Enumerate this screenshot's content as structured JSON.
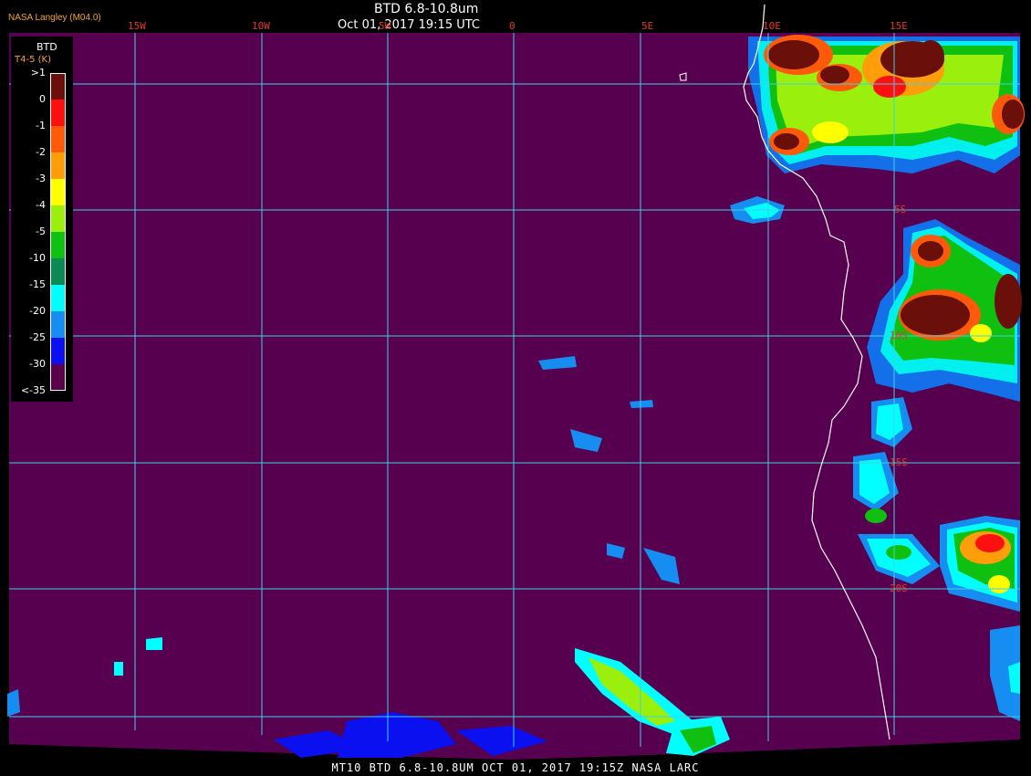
{
  "header": {
    "title": "BTD 6.8-10.8um",
    "subtitle": "Oct 01, 2017 19:15 UTC",
    "org": "NASA Langley (M04.0)"
  },
  "legend": {
    "title": "BTD",
    "subtitle": "T4-5 (K)",
    "items": [
      {
        "label": ">1",
        "color": "#6b0f0a"
      },
      {
        "label": "0",
        "color": "#ff1010"
      },
      {
        "label": "-1",
        "color": "#ff5a0a"
      },
      {
        "label": "-2",
        "color": "#ff9d0a"
      },
      {
        "label": "-3",
        "color": "#ffff00"
      },
      {
        "label": "-4",
        "color": "#9aef0c"
      },
      {
        "label": "-5",
        "color": "#10c210"
      },
      {
        "label": "-10",
        "color": "#0b8a55"
      },
      {
        "label": "-15",
        "color": "#00ffff"
      },
      {
        "label": "-20",
        "color": "#168df0"
      },
      {
        "label": "-25",
        "color": "#0a10f0"
      },
      {
        "label": "-30",
        "color": "#5a004a"
      },
      {
        "label": "<-35",
        "color": ""
      }
    ]
  },
  "grid": {
    "lon_labels": [
      "15W",
      "10W",
      "5W",
      "0",
      "5E",
      "10E",
      "15E"
    ],
    "lat_labels": [
      "5S",
      "10S",
      "15S",
      "20S"
    ]
  },
  "colors": {
    "background": "#580050",
    "grid": "#3fd1e6",
    "coast": "#ffffff",
    "label": "#e03a2a"
  },
  "footer": {
    "text": "MT10  BTD 6.8-10.8UM   OCT 01, 2017 19:15Z   NASA LARC"
  }
}
